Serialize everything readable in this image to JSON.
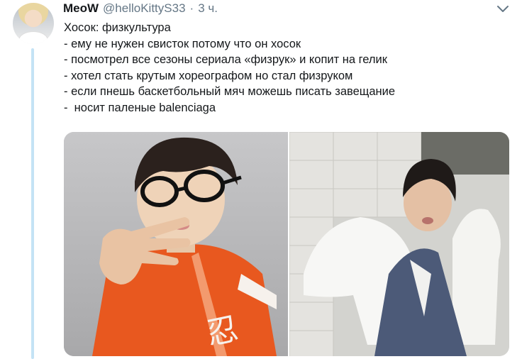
{
  "tweet": {
    "display_name": "MeoW",
    "handle": "@helloKittyS33",
    "separator": "·",
    "time": "3 ч.",
    "lines": [
      "Хосок: физкультура",
      "- ему не нужен свисток потому что он хосок",
      "- посмотрел все сезоны сериала «физрук» и копит на гелик",
      "- хотел стать крутым хореографом но стал физруком",
      "- если пнешь баскетбольный мяч можешь писать завещание",
      "-  носит паленые balenciaga"
    ]
  },
  "icons": {
    "avatar": "user-avatar",
    "caret": "chevron-down-icon"
  },
  "colors": {
    "thread_line": "#c4e3f5",
    "meta_text": "#657786",
    "orange_jacket": "#e8581f"
  }
}
